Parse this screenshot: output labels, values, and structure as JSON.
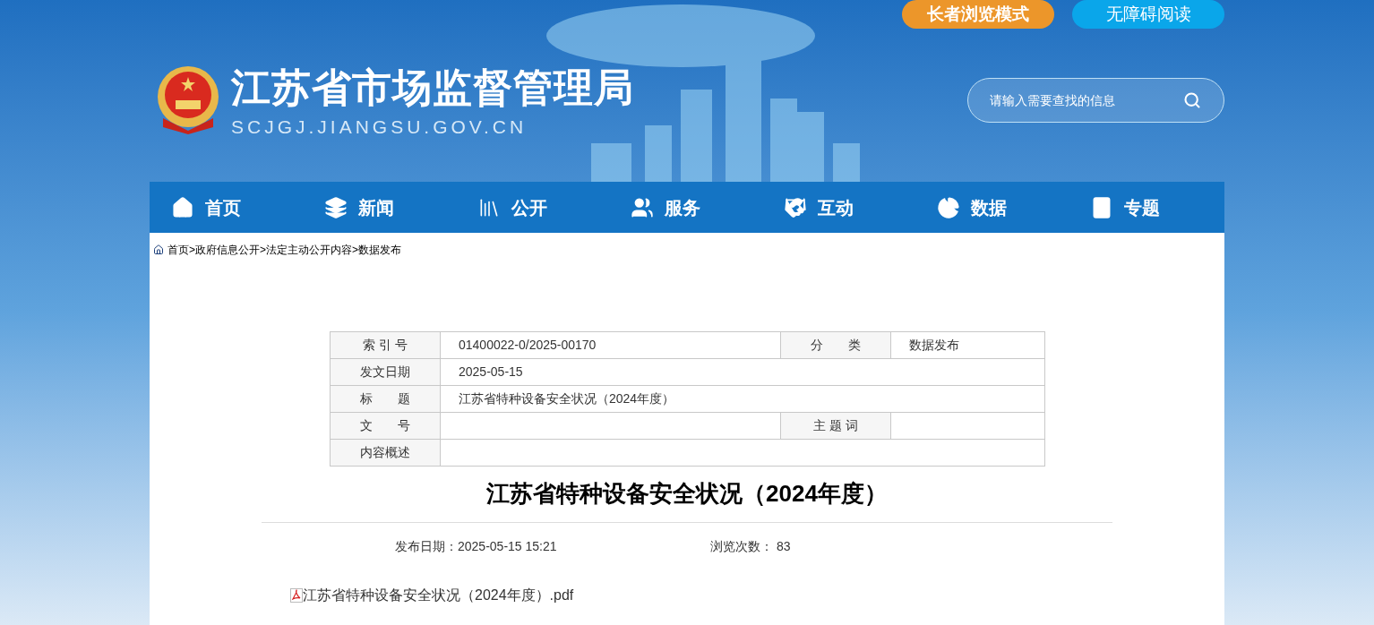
{
  "header": {
    "site_name": "江苏省市场监督管理局",
    "domain": "SCJGJ.JIANGSU.GOV.CN",
    "mode_buttons": [
      {
        "label": "长者浏览模式",
        "kind": "elder"
      },
      {
        "label": "无障碍阅读",
        "kind": "accessible"
      }
    ],
    "search": {
      "placeholder": "请输入需要查找的信息"
    }
  },
  "nav": [
    {
      "label": "首页"
    },
    {
      "label": "新闻"
    },
    {
      "label": "公开"
    },
    {
      "label": "服务"
    },
    {
      "label": "互动"
    },
    {
      "label": "数据"
    },
    {
      "label": "专题"
    }
  ],
  "breadcrumb": [
    "首页",
    "政府信息公开",
    "法定主动公开内容",
    "数据发布"
  ],
  "breadcrumb_separator": ">",
  "meta_rows": [
    {
      "cells": [
        {
          "label": "索 引 号",
          "value": "01400022-0/2025-00170"
        },
        {
          "label": "分　　类",
          "value": "数据发布"
        }
      ]
    },
    {
      "cells": [
        {
          "label": "发文日期",
          "value": "2025-05-15"
        }
      ]
    },
    {
      "cells": [
        {
          "label": "标　　题",
          "value": "江苏省特种设备安全状况（2024年度）"
        }
      ]
    },
    {
      "cells": [
        {
          "label": "文　　号"
        },
        {
          "label": "主 题 词"
        }
      ]
    },
    {
      "cells": [
        {
          "label": "内容概述"
        }
      ]
    }
  ],
  "article": {
    "title": "江苏省特种设备安全状况（2024年度）",
    "publish_date": "发布日期：2025-05-15 15:21",
    "views": "浏览次数： 83",
    "attachment": "江苏省特种设备安全状况（2024年度）.pdf"
  }
}
